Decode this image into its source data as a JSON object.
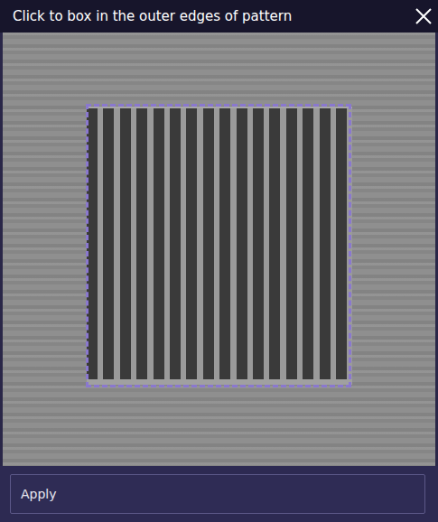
{
  "window": {
    "title": "Click to box in the outer edges of pattern"
  },
  "selection_box": {
    "visible": true
  },
  "buttons": [
    "Apply"
  ]
}
